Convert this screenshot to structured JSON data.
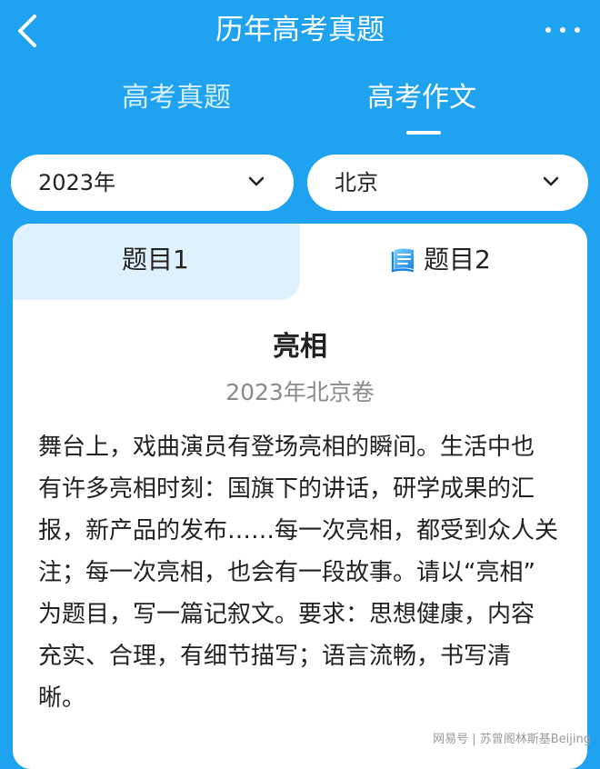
{
  "header": {
    "title": "历年高考真题"
  },
  "tabs": [
    {
      "label": "高考真题",
      "active": false
    },
    {
      "label": "高考作文",
      "active": true
    }
  ],
  "filters": {
    "year": "2023年",
    "region": "北京"
  },
  "question_tabs": [
    {
      "label": "题目1",
      "active": false
    },
    {
      "label": "题目2",
      "active": true
    }
  ],
  "essay": {
    "title": "亮相",
    "source": "2023年北京卷",
    "prompt_lines": [
      "舞台上，戏曲演员有登场亮相的瞬间。生活中也",
      "有许多亮相时刻：国旗下的讲话，研学成果的汇",
      "报，新产品的发布……每一次亮相，都受到众人关",
      "注；每一次亮相，也会有一段故事。请以“亮相”",
      "为题目，写一篇记叙文。要求：思想健康，内容",
      "充实、合理，有细节描写；语言流畅，书写清",
      "晰。"
    ]
  },
  "watermark": "网易号 | 苏曾阁林斯基Beijing",
  "colors": {
    "header_bg": "#1fa3f0",
    "card_bg": "#ffffff",
    "inactive_tab_bg": "#dff1fd",
    "source_text": "#8a8a8a"
  }
}
